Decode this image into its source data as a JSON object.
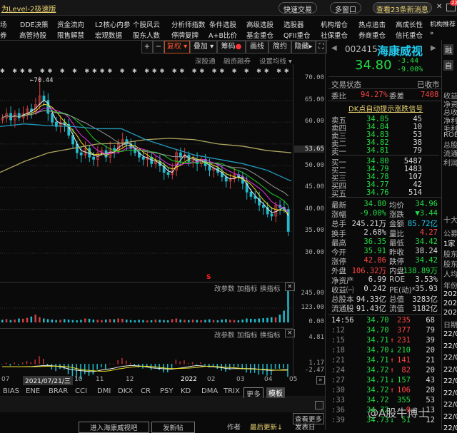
{
  "header": {
    "title": "为Level-2极速版",
    "quick_trade": "快速交易",
    "multi_window": "多窗口",
    "news": "查看23条新消息",
    "badge": "22"
  },
  "menu_row1": [
    "场",
    "DDE决策",
    "资金流向",
    "L2核心内参",
    "个股风云",
    "分析师指数",
    "条件选股",
    "高级选股",
    "选股器",
    "机构增仓",
    "热点追击",
    "高成长性",
    "机构推荐"
  ],
  "menu_row2": [
    "券",
    "高管持股",
    "限售解禁",
    "宏观数据",
    "股东人数",
    "停牌复牌",
    "A+B比价",
    "基金重仓",
    "QFII重仓",
    "社保重仓",
    "券商重仓",
    "信托重仓",
    "»"
  ],
  "toolbar": {
    "plus": "+",
    "minus": "−",
    "fq": "复权",
    "overlay": "叠加",
    "chips": "筹码",
    "draw": "画线",
    "simple": "简约",
    "hide": "隐藏"
  },
  "chart_links": {
    "sgt": "深股通",
    "margin": "融资融券",
    "ma_setting": "设置均线"
  },
  "chart_data": {
    "type": "candlestick",
    "y_ticks": [
      "70.00",
      "65.00",
      "60.00",
      "53.65",
      "50.00",
      "45.00",
      "40.00",
      "35.00",
      "30.00"
    ],
    "ylim": [
      30,
      70
    ],
    "high_label": "70.44",
    "signal_label": "S",
    "closes": [
      61,
      62,
      60.5,
      62,
      61,
      62,
      63,
      62.5,
      64,
      66,
      65,
      62,
      60,
      59,
      60,
      59.5,
      57,
      55,
      53,
      52.5,
      54,
      52,
      51.5,
      53,
      53.5,
      52,
      54,
      53.5,
      55,
      56,
      55,
      54,
      53,
      52,
      51.5,
      52,
      50.5,
      51,
      50,
      48.5,
      48,
      49,
      53,
      52,
      52.5,
      51,
      51.5,
      50.5,
      51.5,
      50,
      49,
      49.5,
      48.5,
      47.5,
      46.5,
      47,
      48,
      47.5,
      46,
      44,
      43,
      42.5,
      41,
      40.5,
      39,
      38.5,
      41,
      40.5,
      40,
      35
    ],
    "ma_long_a": [
      48.5,
      51,
      53,
      54,
      55,
      55.2,
      56,
      56.3,
      56,
      55,
      54.5,
      53.5,
      53
    ],
    "ma_long_b": [
      59,
      59.6,
      59.2,
      59,
      58.5,
      58.5,
      56,
      54.2,
      52.5,
      51.5,
      50.5,
      49,
      46.5
    ],
    "volume": {
      "y_ticks": [
        "245.00",
        "123.00",
        "0.00"
      ],
      "values": [
        20,
        25,
        18,
        22,
        30,
        28,
        35,
        45,
        60,
        40,
        30,
        25,
        22,
        18,
        20,
        25,
        22,
        18,
        16,
        20,
        30,
        28,
        22,
        20,
        18,
        22,
        25,
        24,
        30,
        28,
        22,
        18,
        16,
        20,
        18,
        15,
        17,
        22,
        20,
        18,
        16,
        25,
        30,
        22,
        20,
        18,
        22,
        19,
        17,
        20,
        24,
        18,
        16,
        22,
        25,
        20,
        18,
        16,
        22,
        30,
        28,
        26,
        30,
        32,
        35,
        40,
        38,
        60,
        90,
        245
      ]
    },
    "macd": {
      "y_ticks": [
        "4.81",
        "1.17",
        "-2.47"
      ]
    },
    "x_ticks": [
      "07",
      "2021/07/21/三",
      "10",
      "11",
      "12",
      "2022",
      "02",
      "03",
      "04",
      "05"
    ]
  },
  "panel_buttons": {
    "param": "改参数",
    "add": "加指标",
    "swap": "换指标",
    "close": "×"
  },
  "indicators": [
    "BIAS",
    "ENE",
    "BRAR",
    "CCI",
    "DMI",
    "DKX",
    "CR",
    "PSY",
    "KD",
    "DMA",
    "TRIX",
    "更多",
    "模板"
  ],
  "bottom": {
    "more": "查看更多",
    "enter_bar": "进入海康威视吧",
    "post": "发新帖",
    "author": "作者",
    "latest": "最后更新↓",
    "published": "发表日"
  },
  "quote": {
    "code": "002415",
    "name": "海康威视",
    "price": "34.80",
    "change": "-3.44",
    "pct": "-9.00%",
    "status_label": "交易状态",
    "status": "已收市",
    "wb_label": "委比",
    "wb": "94.27%",
    "wc_label": "委差",
    "wc": "7408",
    "signal": "DK点自动提示涨跌信号",
    "asks": [
      [
        "卖五",
        "34.85",
        "45"
      ],
      [
        "卖四",
        "34.84",
        "10"
      ],
      [
        "卖三",
        "34.83",
        "53"
      ],
      [
        "卖二",
        "34.82",
        "38"
      ],
      [
        "卖一",
        "34.81",
        "79"
      ]
    ],
    "bids": [
      [
        "买一",
        "34.80",
        "5487"
      ],
      [
        "买二",
        "34.79",
        "1483"
      ],
      [
        "买三",
        "34.78",
        "107"
      ],
      [
        "买四",
        "34.77",
        "42"
      ],
      [
        "买五",
        "34.76",
        "514"
      ]
    ],
    "stats": [
      [
        "最新",
        "34.80",
        "g",
        "均价",
        "34.96",
        "g"
      ],
      [
        "涨幅",
        "-9.00%",
        "g",
        "涨跌",
        "▼3.44",
        "g"
      ],
      [
        "总手",
        "245.21万",
        "w",
        "金额",
        "85.72亿",
        "c"
      ],
      [
        "换手",
        "2.68%",
        "w",
        "量比",
        "4.27",
        "r"
      ],
      [
        "最高",
        "36.35",
        "g",
        "最低",
        "34.42",
        "g"
      ],
      [
        "今开",
        "35.91",
        "g",
        "昨收",
        "38.24",
        "w"
      ],
      [
        "涨停",
        "42.06",
        "r",
        "跌停",
        "34.42",
        "g"
      ],
      [
        "外盘",
        "106.32万",
        "r",
        "内盘",
        "138.89万",
        "g"
      ],
      [
        "净资产",
        "6.99",
        "w",
        "ROE",
        "3.53%",
        "w"
      ],
      [
        "收益㈠",
        "0.242",
        "w",
        "PE(动)*",
        "35.93",
        "w"
      ],
      [
        "总股本",
        "94.33亿",
        "w",
        "总值",
        "3283亿",
        "w"
      ],
      [
        "流通股",
        "91.43亿",
        "w",
        "流值",
        "3182亿",
        "w"
      ]
    ],
    "ticks": [
      [
        "14:56",
        "34.70",
        "",
        "235",
        "r",
        "68"
      ],
      [
        ":12",
        "34.70",
        "",
        "377",
        "r",
        "79"
      ],
      [
        ":15",
        "34.71",
        "↑",
        "231",
        "r",
        "39"
      ],
      [
        ":18",
        "34.70",
        "↓",
        "210",
        "g",
        "20"
      ],
      [
        ":21",
        "34.71",
        "↑",
        "141",
        "r",
        "21"
      ],
      [
        ":24",
        "34.72",
        "↑",
        "82",
        "r",
        "20"
      ],
      [
        ":27",
        "34.71",
        "↓",
        "157",
        "g",
        "43"
      ],
      [
        ":30",
        "34.72",
        "↑",
        "106",
        "r",
        "20"
      ],
      [
        ":33",
        "34.72",
        "",
        "355",
        "g",
        "53"
      ],
      [
        ":36",
        "34.72",
        "",
        "9",
        "r",
        "13"
      ],
      [
        ":39",
        "34.73",
        "↓",
        "51",
        "g",
        "12"
      ]
    ]
  },
  "side_strip": {
    "rong": "融",
    "zi": "自",
    "items": [
      "收益",
      "净资",
      "总收",
      "净利",
      "毛利",
      "ROE",
      "总股",
      "流通"
    ],
    "profit": "利润",
    "top10": "十大",
    "fund": "公募",
    "one": "1家",
    "holder1": "股东",
    "holder2": "股东",
    "avg": "人均",
    "year": "年份",
    "y1": "202",
    "y2": "202",
    "y3": "202",
    "date": "日期",
    "dates": [
      "22/0",
      "22/0",
      "22/0",
      "22/0",
      "22/0",
      "22/0",
      "22/0",
      "22/0",
      "22/0"
    ]
  },
  "watermark": "@A股牛博士"
}
